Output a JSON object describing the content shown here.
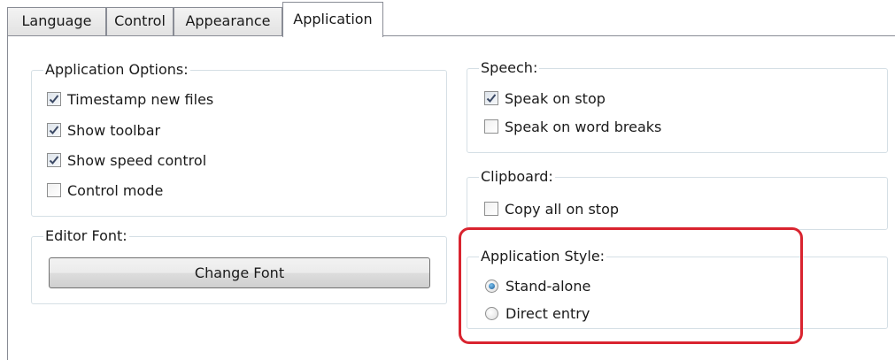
{
  "tabs": [
    {
      "label": "Language",
      "active": false
    },
    {
      "label": "Control",
      "active": false
    },
    {
      "label": "Appearance",
      "active": false
    },
    {
      "label": "Application",
      "active": true
    }
  ],
  "application_options": {
    "title": "Application Options:",
    "items": [
      {
        "label": "Timestamp new files",
        "checked": true
      },
      {
        "label": "Show toolbar",
        "checked": true
      },
      {
        "label": "Show speed control",
        "checked": true
      },
      {
        "label": "Control mode",
        "checked": false
      }
    ]
  },
  "editor_font": {
    "title": "Editor Font:",
    "button_label": "Change Font"
  },
  "speech": {
    "title": "Speech:",
    "items": [
      {
        "label": "Speak on stop",
        "checked": true
      },
      {
        "label": "Speak on word breaks",
        "checked": false
      }
    ]
  },
  "clipboard": {
    "title": "Clipboard:",
    "items": [
      {
        "label": "Copy all on stop",
        "checked": false
      }
    ]
  },
  "application_style": {
    "title": "Application Style:",
    "options": [
      {
        "label": "Stand-alone",
        "selected": true
      },
      {
        "label": "Direct entry",
        "selected": false
      }
    ]
  },
  "colors": {
    "highlight": "#d9242f",
    "group_border": "#d5dfe5",
    "check_mark": "#3c4a66"
  }
}
